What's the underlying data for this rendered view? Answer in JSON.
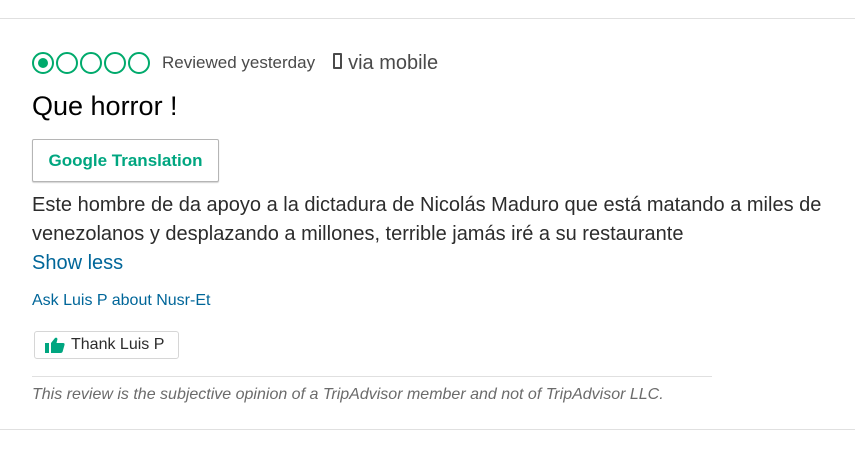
{
  "review": {
    "rating": {
      "value": 1,
      "max": 5,
      "accent_color": "#00aa6c"
    },
    "date": "Reviewed yesterday",
    "source_icon": "mobile-phone-icon",
    "source_text": "via mobile",
    "title": "Que horror !",
    "translate_button": "Google Translation",
    "body": "Este hombre de da apoyo a la dictadura de Nicolás Maduro que está matando a miles de venezolanos y desplazando a millones, terrible jamás iré a su restaurante",
    "show_less": "Show less",
    "ask_link": "Ask Luis P about Nusr-Et",
    "thank_icon": "thumbs-up-icon",
    "thank_button": "Thank Luis P",
    "disclaimer": "This review is the subjective opinion of a TripAdvisor member and not of TripAdvisor LLC."
  }
}
